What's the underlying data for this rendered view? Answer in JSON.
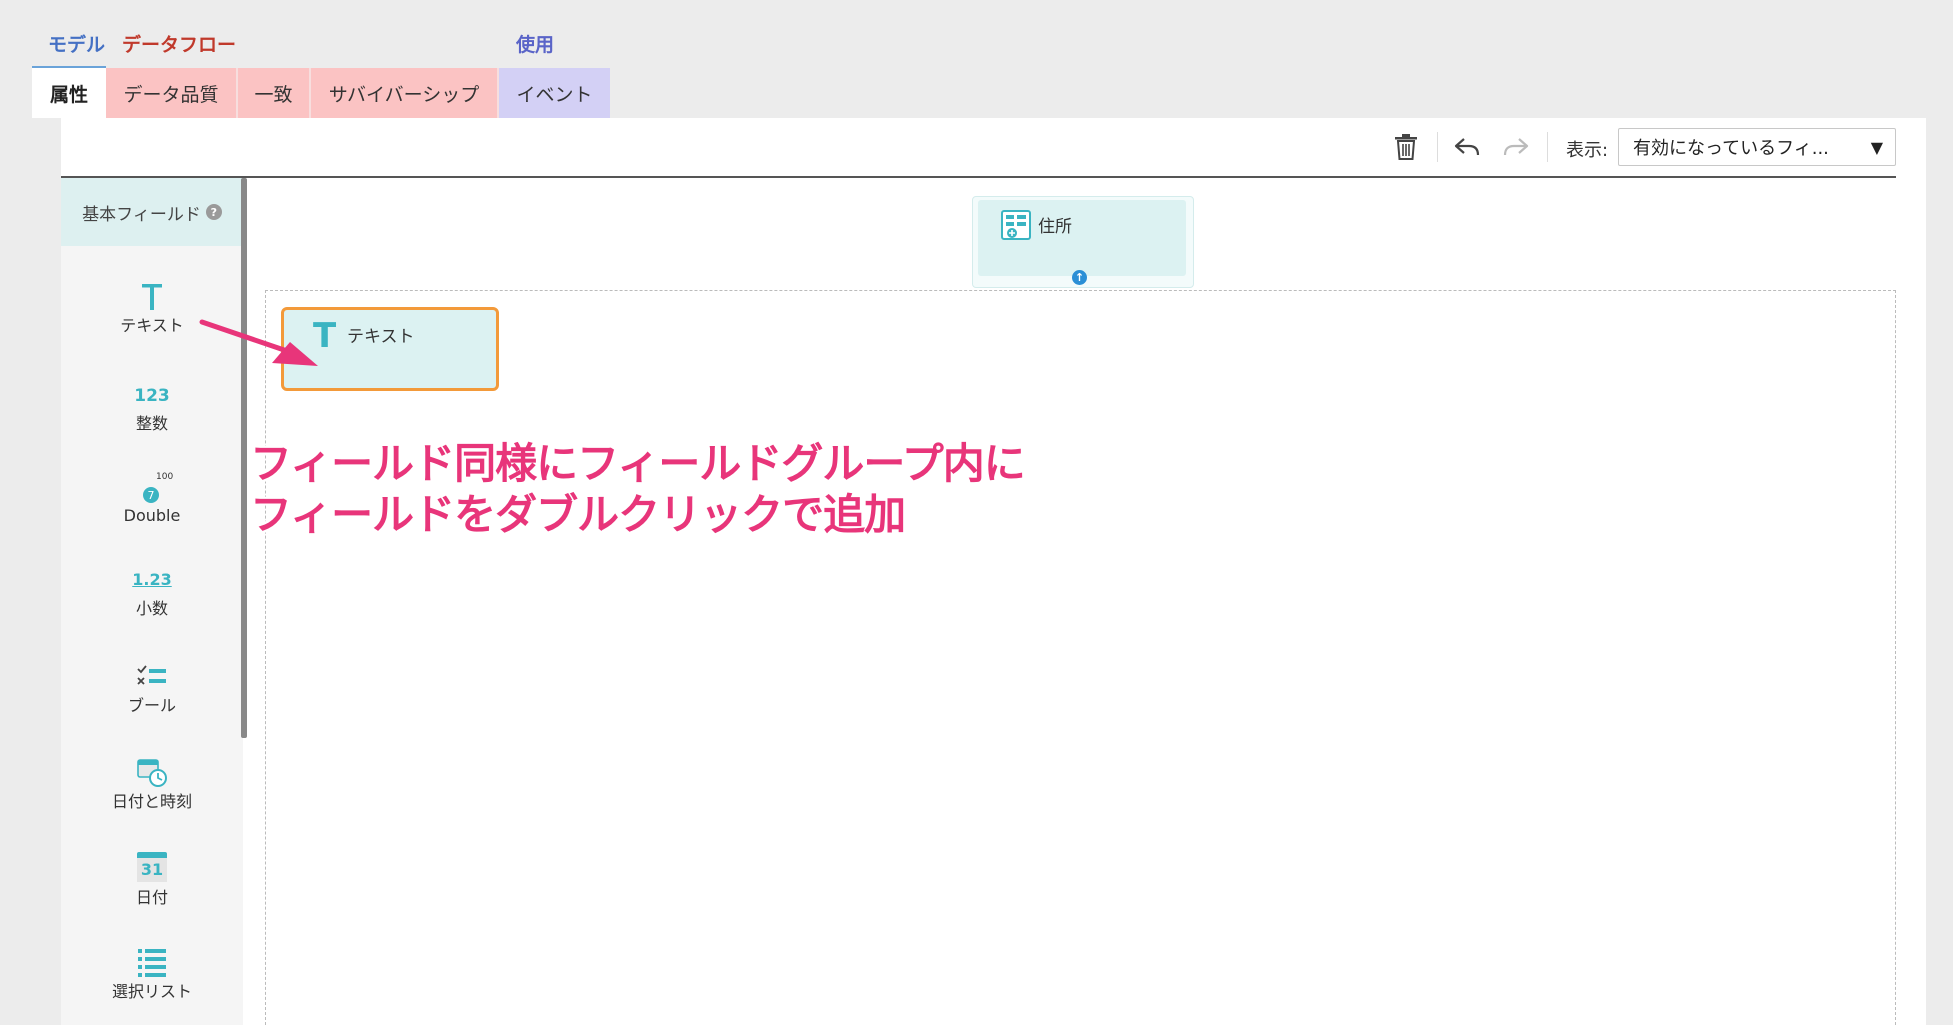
{
  "categories": {
    "model": "モデル",
    "dataflow": "データフロー",
    "use": "使用"
  },
  "tabs": [
    {
      "label": "属性",
      "state": "active"
    },
    {
      "label": "データ品質",
      "state": "dataflow"
    },
    {
      "label": "一致",
      "state": "dataflow"
    },
    {
      "label": "サバイバーシップ",
      "state": "dataflow"
    },
    {
      "label": "イベント",
      "state": "use"
    }
  ],
  "toolbar": {
    "view_label": "表示:",
    "view_value": "有効になっているフィ...",
    "icons": [
      "trash-icon",
      "undo-icon",
      "redo-icon"
    ]
  },
  "sidebar": {
    "title": "基本フィールド",
    "help": "?",
    "items": [
      {
        "label": "テキスト",
        "icon": "T"
      },
      {
        "label": "整数",
        "icon": "123"
      },
      {
        "label": "Double",
        "icon": "100"
      },
      {
        "label": "小数",
        "icon": "1.23"
      },
      {
        "label": "ブール",
        "icon": "boolean-icon"
      },
      {
        "label": "日付と時刻",
        "icon": "datetime-icon"
      },
      {
        "label": "日付",
        "icon": "31"
      },
      {
        "label": "選択リスト",
        "icon": "list-icon"
      }
    ]
  },
  "canvas": {
    "group_label": "住所",
    "field_label": "テキスト",
    "field_icon": "T"
  },
  "annotation": {
    "line1": "フィールド同様にフィールドグループ内に",
    "line2": "フィールドをダブルクリックで追加",
    "color": "#e8357a"
  },
  "colors": {
    "accent": "#3ab4c2",
    "highlight": "#f39a3a",
    "dataflow_tab": "#fbc3c3",
    "use_tab": "#d3d0f5"
  }
}
